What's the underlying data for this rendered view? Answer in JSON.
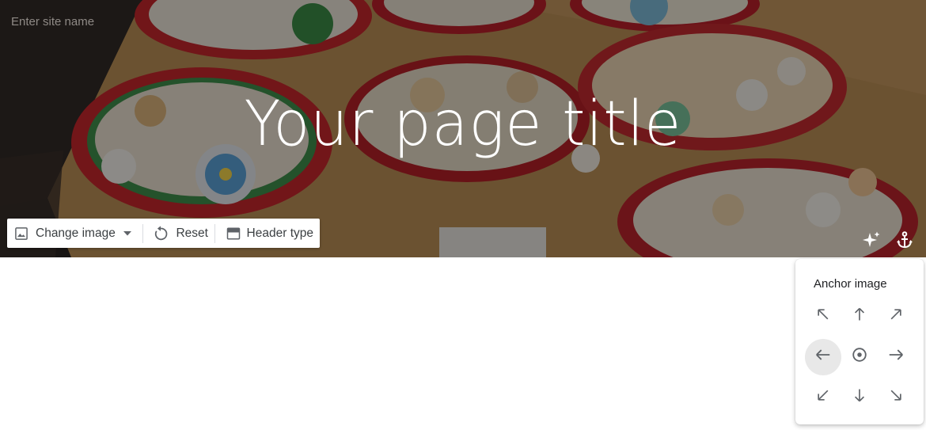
{
  "header": {
    "site_name_placeholder": "Enter site name",
    "page_title": "Your page title"
  },
  "toolbar": {
    "change_image_label": "Change image",
    "reset_label": "Reset",
    "header_type_label": "Header type"
  },
  "header_icons": [
    "sparkle-icon",
    "anchor-icon"
  ],
  "anchor_popup": {
    "title": "Anchor image",
    "positions": [
      "top-left",
      "top",
      "top-right",
      "left",
      "center",
      "right",
      "bottom-left",
      "bottom",
      "bottom-right"
    ],
    "selected": "left"
  },
  "colors": {
    "icon_gray": "#5f6368",
    "selected_bg": "#e8e8e8",
    "table_wood": "#b98d55",
    "plate_red": "#b8202a"
  }
}
